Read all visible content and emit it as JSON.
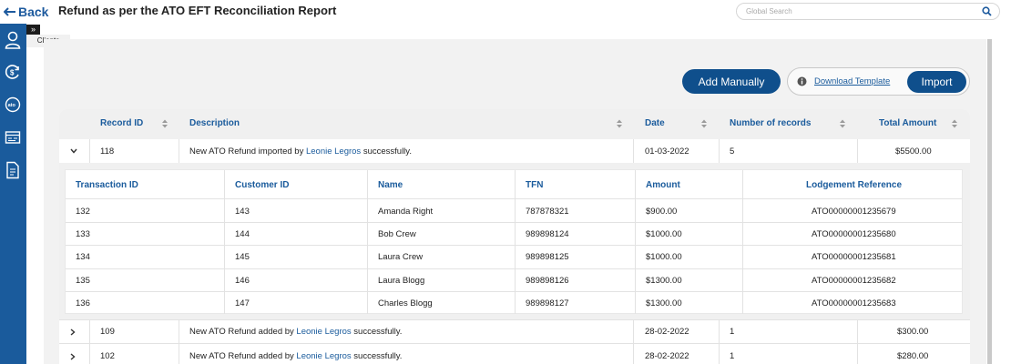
{
  "header": {
    "back_label": "Back",
    "title": "Refund as per the ATO EFT Reconciliation Report",
    "search_placeholder": "Global Search"
  },
  "sidebar": {
    "expander": "»",
    "tooltip": "Clients",
    "icons": [
      "user-icon",
      "refund-icon",
      "ato-icon",
      "calendar-report-icon",
      "document-report-icon"
    ]
  },
  "actions": {
    "add_manually": "Add Manually",
    "download_template": "Download Template",
    "import": "Import"
  },
  "table": {
    "columns": [
      "Record ID",
      "Description",
      "Date",
      "Number of records",
      "Total Amount"
    ],
    "rows": [
      {
        "record_id": "118",
        "desc_prefix": "New ATO Refund imported by ",
        "desc_user": "Leonie Legros",
        "desc_suffix": " successfully.",
        "date": "01-03-2022",
        "records": "5",
        "total": "$5500.00",
        "expanded": true
      },
      {
        "record_id": "109",
        "desc_prefix": "New ATO Refund added by ",
        "desc_user": "Leonie Legros",
        "desc_suffix": " successfully.",
        "date": "28-02-2022",
        "records": "1",
        "total": "$300.00",
        "expanded": false
      },
      {
        "record_id": "102",
        "desc_prefix": "New ATO Refund added by ",
        "desc_user": "Leonie Legros",
        "desc_suffix": " successfully.",
        "date": "28-02-2022",
        "records": "1",
        "total": "$280.00",
        "expanded": false
      }
    ]
  },
  "nested": {
    "columns": [
      "Transaction ID",
      "Customer ID",
      "Name",
      "TFN",
      "Amount",
      "Lodgement Reference"
    ],
    "rows": [
      {
        "txn": "132",
        "cust": "143",
        "name": "Amanda Right",
        "tfn": "787878321",
        "amount": "$900.00",
        "ref": "ATO00000001235679"
      },
      {
        "txn": "133",
        "cust": "144",
        "name": "Bob Crew",
        "tfn": "989898124",
        "amount": "$1000.00",
        "ref": "ATO00000001235680"
      },
      {
        "txn": "134",
        "cust": "145",
        "name": "Laura Crew",
        "tfn": "989898125",
        "amount": "$1000.00",
        "ref": "ATO00000001235681"
      },
      {
        "txn": "135",
        "cust": "146",
        "name": "Laura Blogg",
        "tfn": "989898126",
        "amount": "$1300.00",
        "ref": "ATO00000001235682"
      },
      {
        "txn": "136",
        "cust": "147",
        "name": "Charles Blogg",
        "tfn": "989898127",
        "amount": "$1300.00",
        "ref": "ATO00000001235683"
      }
    ]
  }
}
